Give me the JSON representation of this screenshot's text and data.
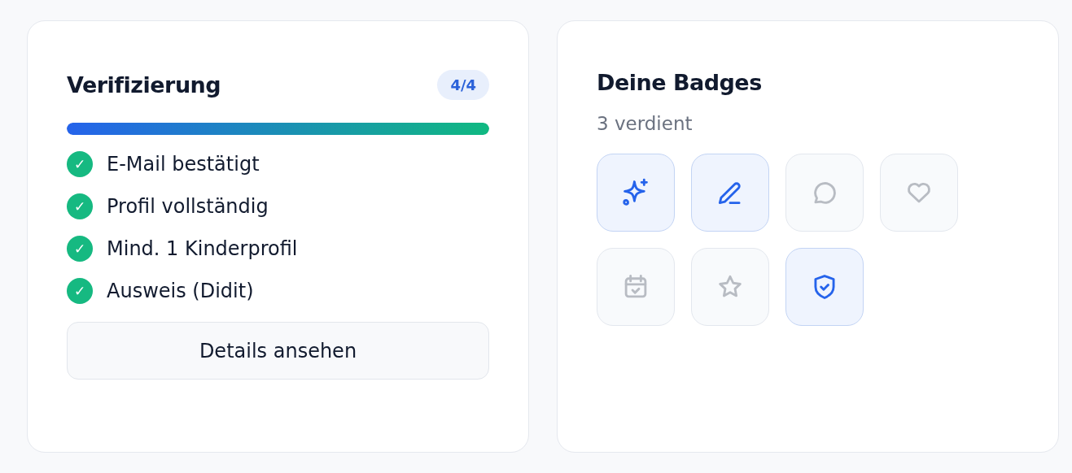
{
  "verification": {
    "title": "Verifizierung",
    "count": "4/4",
    "level": 1,
    "items": [
      {
        "label": "E-Mail bestätigt",
        "checked": true,
        "mark": "✓"
      },
      {
        "label": "Profil vollständig",
        "checked": true,
        "mark": "✓"
      },
      {
        "label": "Mind. 1 Kinderprofil",
        "checked": true,
        "mark": "✓"
      },
      {
        "label": "Ausweis (Didit)",
        "checked": true,
        "mark": "✓"
      }
    ],
    "button": "Details ansehen"
  },
  "badges": {
    "title": "Deine Badges",
    "subtitle": "3 verdient",
    "items": [
      {
        "kind": "sparkles",
        "earned": true
      },
      {
        "kind": "pen",
        "earned": true
      },
      {
        "kind": "chat",
        "earned": false
      },
      {
        "kind": "heart",
        "earned": false
      },
      {
        "kind": "calendar",
        "earned": false
      },
      {
        "kind": "star",
        "earned": false
      },
      {
        "kind": "shield",
        "earned": true
      }
    ]
  }
}
